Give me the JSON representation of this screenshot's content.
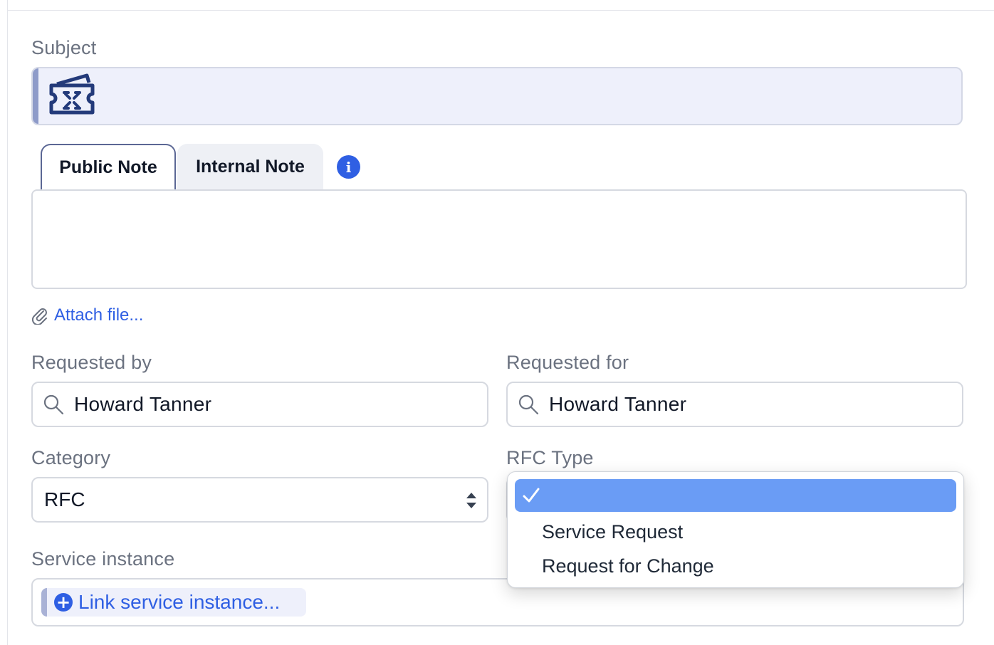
{
  "form": {
    "subject": {
      "label": "Subject",
      "value": ""
    },
    "tabs": [
      {
        "label": "Public Note",
        "active": true
      },
      {
        "label": "Internal Note",
        "active": false
      }
    ],
    "info_icon": "i",
    "note": {
      "value": ""
    },
    "attach": {
      "label": "Attach file..."
    },
    "requested_by": {
      "label": "Requested by",
      "value": "Howard Tanner"
    },
    "requested_for": {
      "label": "Requested for",
      "value": "Howard Tanner"
    },
    "category": {
      "label": "Category",
      "value": "RFC"
    },
    "rfc_type": {
      "label": "RFC Type",
      "options": [
        {
          "label": "",
          "selected": true
        },
        {
          "label": "Service Request",
          "selected": false
        },
        {
          "label": "Request for Change",
          "selected": false
        }
      ]
    },
    "service_instance": {
      "label": "Service instance",
      "link_label": "Link service instance..."
    }
  },
  "icons": {
    "subject": "ticket-icon",
    "info": "info-icon",
    "attach": "paperclip-icon",
    "search": "search-icon",
    "select": "updown-arrows-icon",
    "check": "checkmark-icon",
    "plus": "plus-circle-icon"
  },
  "colors": {
    "accent_blue": "#2f5fe3",
    "selected_option": "#6a9cf5",
    "subject_bg": "#eef0fb"
  }
}
